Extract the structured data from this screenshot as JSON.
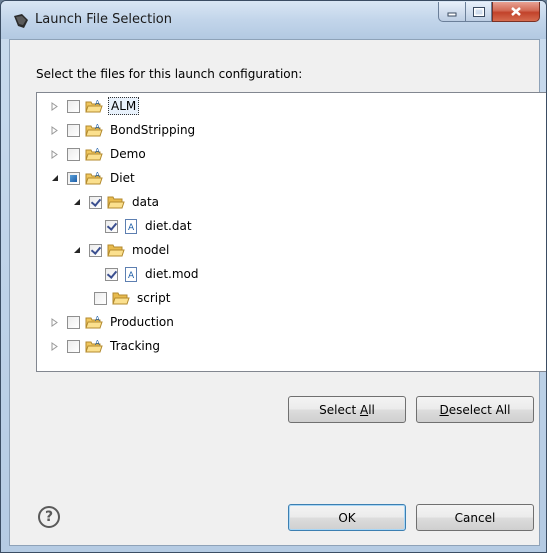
{
  "window": {
    "title": "Launch File Selection",
    "controls": {
      "minimize": "minimize",
      "maximize": "maximize",
      "close": "close"
    }
  },
  "prompt": "Select the files for this launch configuration:",
  "tree": {
    "items": [
      {
        "label": "ALM",
        "depth": 0,
        "expander": "collapsed",
        "check": "unchecked",
        "icon": "project-folder-icon",
        "selected": true
      },
      {
        "label": "BondStripping",
        "depth": 0,
        "expander": "collapsed",
        "check": "unchecked",
        "icon": "project-folder-icon"
      },
      {
        "label": "Demo",
        "depth": 0,
        "expander": "collapsed",
        "check": "unchecked",
        "icon": "project-folder-icon"
      },
      {
        "label": "Diet",
        "depth": 0,
        "expander": "expanded",
        "check": "partial",
        "icon": "project-folder-icon"
      },
      {
        "label": "data",
        "depth": 1,
        "expander": "expanded",
        "check": "checked",
        "icon": "folder-open-icon"
      },
      {
        "label": "diet.dat",
        "depth": 2,
        "expander": "none",
        "check": "checked",
        "icon": "file-icon"
      },
      {
        "label": "model",
        "depth": 1,
        "expander": "expanded",
        "check": "checked",
        "icon": "folder-open-icon"
      },
      {
        "label": "diet.mod",
        "depth": 2,
        "expander": "none",
        "check": "checked",
        "icon": "file-icon"
      },
      {
        "label": "script",
        "depth": 1,
        "expander": "none",
        "check": "unchecked",
        "icon": "folder-open-icon"
      },
      {
        "label": "Production",
        "depth": 0,
        "expander": "collapsed",
        "check": "unchecked",
        "icon": "project-folder-icon"
      },
      {
        "label": "Tracking",
        "depth": 0,
        "expander": "collapsed",
        "check": "unchecked",
        "icon": "project-folder-icon"
      }
    ]
  },
  "buttons": {
    "select_all": {
      "pre": "Select ",
      "mnemonic": "A",
      "post": "ll"
    },
    "deselect_all": {
      "pre": "",
      "mnemonic": "D",
      "post": "eselect All"
    },
    "ok": "OK",
    "cancel": "Cancel"
  },
  "help": {
    "glyph": "?"
  },
  "colors": {
    "accent": "#3c7fb1",
    "check": "#3b4f8f",
    "close_button": "#c2422a"
  }
}
